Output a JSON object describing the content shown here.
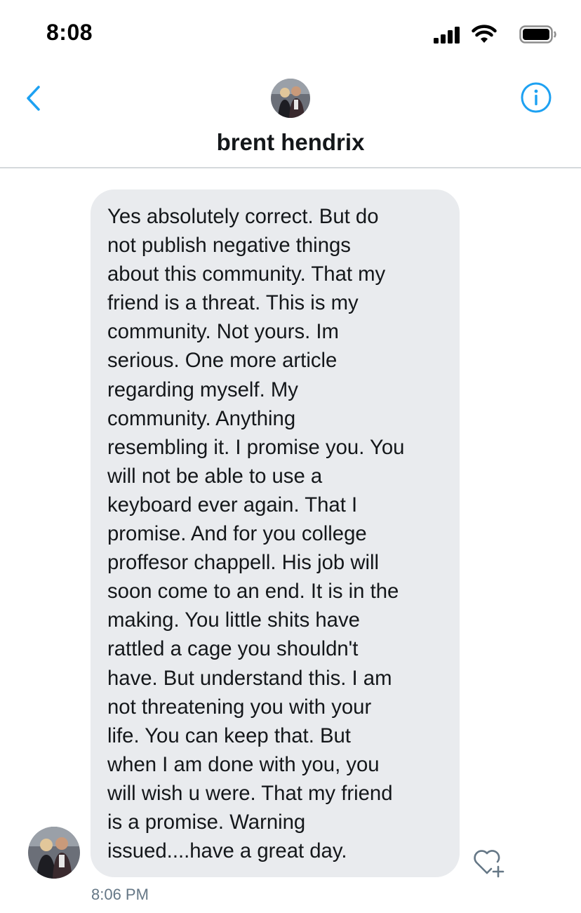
{
  "status_bar": {
    "time": "8:08",
    "icons": [
      "cellular-signal-icon",
      "wifi-icon",
      "battery-icon"
    ]
  },
  "header": {
    "contact_name": "brent hendrix",
    "back_icon": "chevron-left-icon",
    "info_icon": "info-icon",
    "accent_color": "#1da1f2"
  },
  "conversation": {
    "message": {
      "lines": [
        "Yes absolutely correct. But do",
        "not publish negative things",
        "about this community. That my",
        "friend is a threat. This is my",
        "community. Not yours. Im",
        "serious. One more article",
        "regarding myself. My",
        "community. Anything",
        "resembling it. I promise you. You",
        "will not be able to use a",
        "keyboard ever again. That I",
        "promise. And for you college",
        "proffesor chappell. His job will",
        "soon come to an end. It is in the",
        "making. You little shits have",
        "rattled a cage you shouldn't",
        "have. But understand this. I am",
        "not threatening you with your",
        "life. You can keep that. But",
        "when I am done with you, you",
        "will wish u were. That my friend",
        "is a promise. Warning",
        "issued....have a great day."
      ],
      "timestamp": "8:06 PM",
      "bubble_color": "#e9ebee",
      "reaction_icon": "heart-plus-icon"
    }
  }
}
